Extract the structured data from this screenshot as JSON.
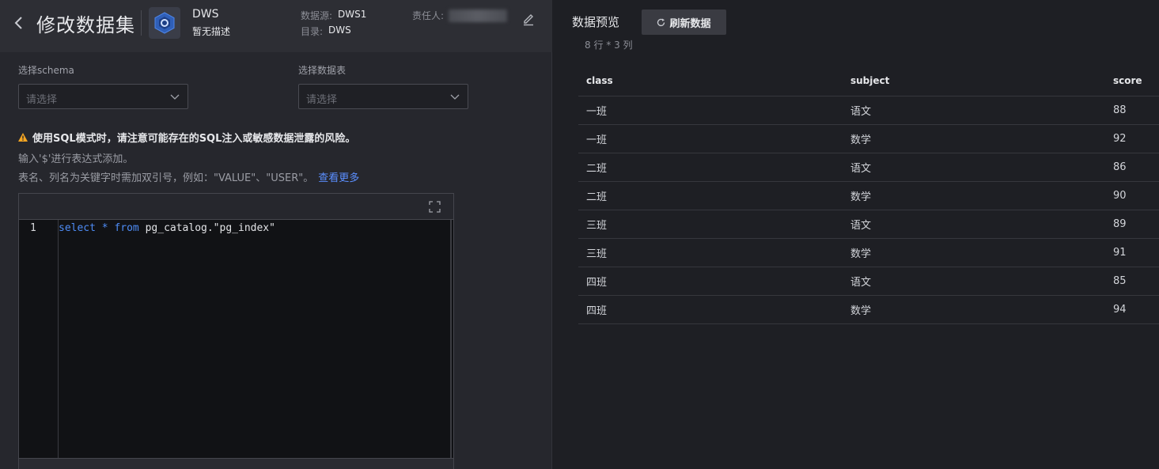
{
  "header": {
    "title": "修改数据集",
    "datasource_name": "DWS",
    "datasource_desc": "暂无描述",
    "source_label": "数据源:",
    "source_value": "DWS1",
    "dir_label": "目录:",
    "dir_value": "DWS",
    "owner_label": "责任人:"
  },
  "form": {
    "schema_label": "选择schema",
    "schema_placeholder": "请选择",
    "table_label": "选择数据表",
    "table_placeholder": "请选择"
  },
  "notice": {
    "warning": "使用SQL模式时，请注意可能存在的SQL注入或敏感数据泄露的风险。",
    "hint1": "输入'$'进行表达式添加。",
    "hint2": "表名、列名为关键字时需加双引号，例如：\"VALUE\"、\"USER\"。",
    "link": "查看更多"
  },
  "editor": {
    "line_number": "1",
    "kw_select": "select",
    "star": " * ",
    "kw_from": "from",
    "rest": " pg_catalog.\"pg_index\""
  },
  "preview": {
    "title": "数据预览",
    "refresh_label": "刷新数据",
    "row_info": "8 行 * 3 列",
    "columns": [
      "class",
      "subject",
      "score"
    ],
    "rows": [
      [
        "一班",
        "语文",
        "88"
      ],
      [
        "一班",
        "数学",
        "92"
      ],
      [
        "二班",
        "语文",
        "86"
      ],
      [
        "二班",
        "数学",
        "90"
      ],
      [
        "三班",
        "语文",
        "89"
      ],
      [
        "三班",
        "数学",
        "91"
      ],
      [
        "四班",
        "语文",
        "85"
      ],
      [
        "四班",
        "数学",
        "94"
      ]
    ]
  },
  "colors": {
    "accent_link": "#5b8fff",
    "keyword": "#4e8cf6",
    "warning": "#f5a623"
  },
  "icons": [
    "back-arrow-icon",
    "datasource-icon",
    "edit-icon",
    "chevron-down-icon",
    "warning-icon",
    "fullscreen-icon",
    "refresh-icon"
  ]
}
